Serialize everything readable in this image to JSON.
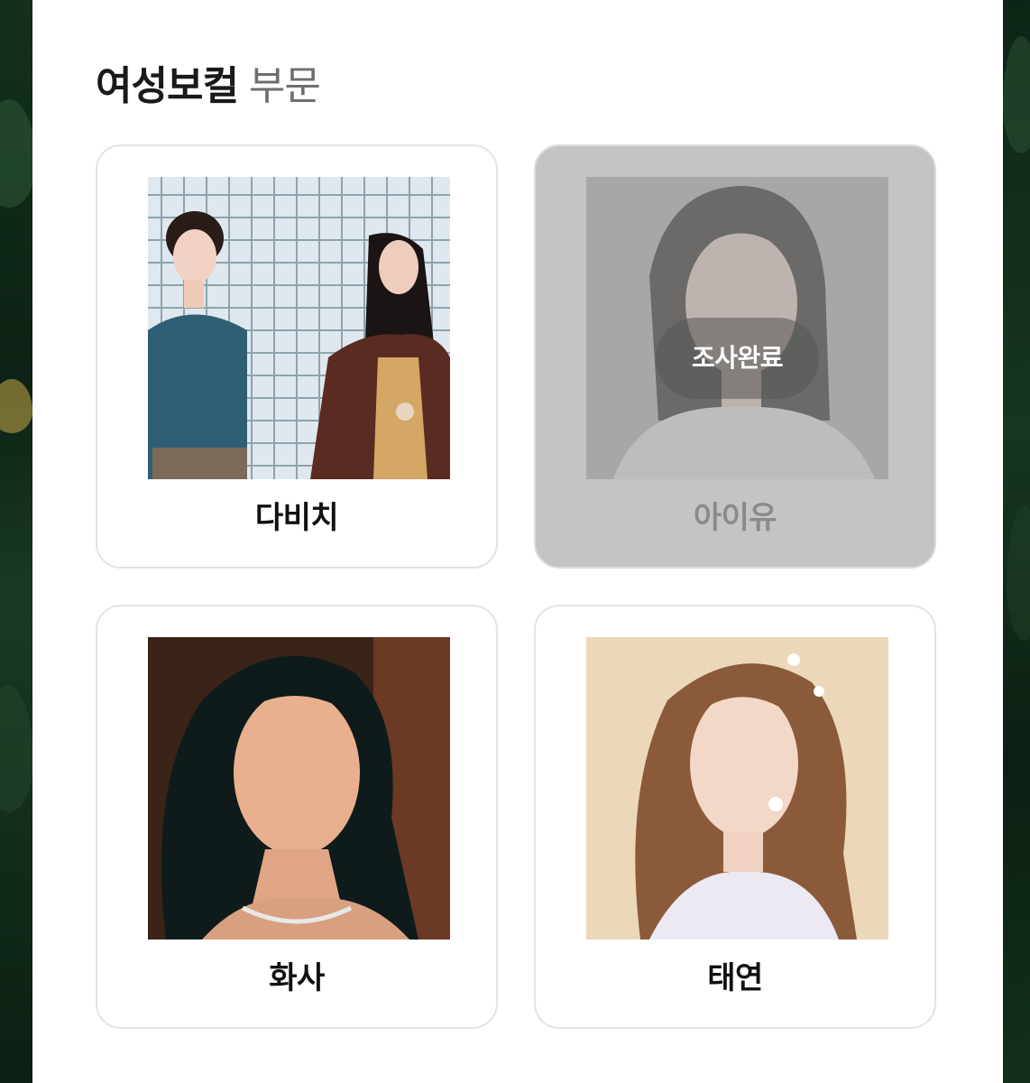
{
  "section": {
    "title_strong": "여성보컬",
    "title_light": "부문"
  },
  "candidates": [
    {
      "name": "다비치",
      "status": ""
    },
    {
      "name": "아이유",
      "status": "조사완료"
    },
    {
      "name": "화사",
      "status": ""
    },
    {
      "name": "태연",
      "status": ""
    }
  ],
  "colors": {
    "panel_bg": "#ffffff",
    "page_bg": "#0f2416",
    "card_border": "#e3e3e3",
    "card_done_bg": "#c4c4c4",
    "name_text": "#111111",
    "name_done_text": "#8a8a8a"
  }
}
